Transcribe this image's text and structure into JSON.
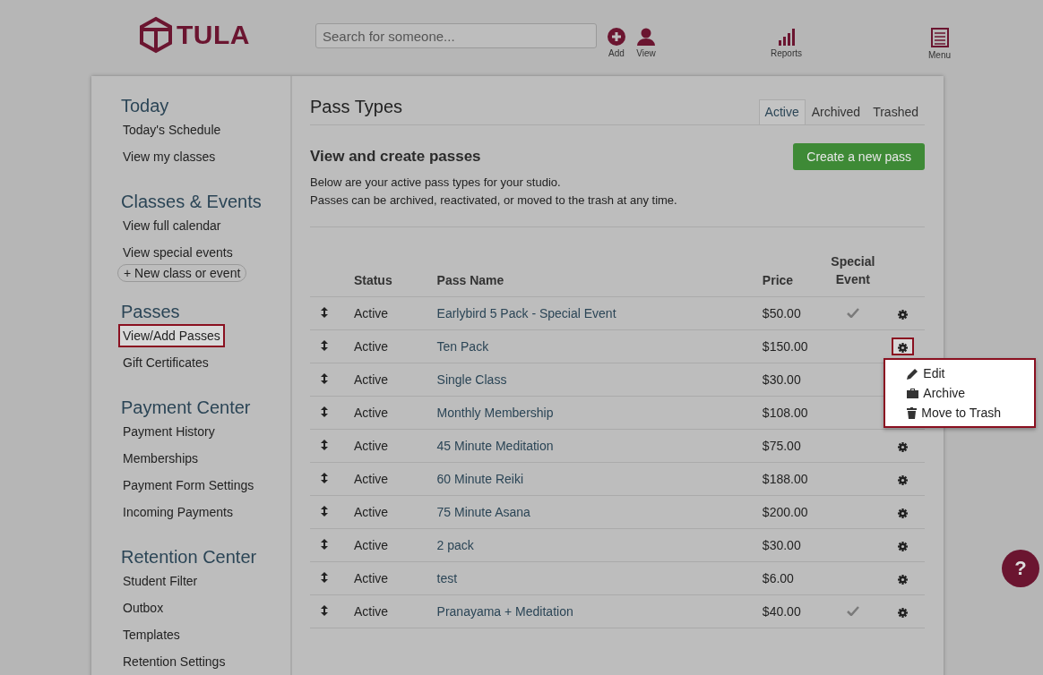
{
  "header": {
    "logo": "TULA",
    "search": {
      "placeholder": "Search for someone..."
    },
    "actions": [
      {
        "kind": "add",
        "label": "Add"
      },
      {
        "kind": "view",
        "label": "View"
      },
      {
        "kind": "reports",
        "label": "Reports"
      },
      {
        "kind": "menu",
        "label": "Menu"
      }
    ]
  },
  "sidebar": {
    "sections": [
      {
        "heading": "Today",
        "items": [
          {
            "kind": "link",
            "label": "Today's Schedule",
            "highlighted": false
          },
          {
            "kind": "link",
            "label": "View my classes",
            "highlighted": false
          }
        ]
      },
      {
        "heading": "Classes & Events",
        "items": [
          {
            "kind": "link",
            "label": "View full calendar",
            "highlighted": false
          },
          {
            "kind": "link",
            "label": "View special events",
            "highlighted": false
          },
          {
            "kind": "button",
            "label": "+ New class or event",
            "highlighted": false
          }
        ]
      },
      {
        "heading": "Passes",
        "items": [
          {
            "kind": "link",
            "label": "View/Add Passes",
            "highlighted": true
          },
          {
            "kind": "link",
            "label": "Gift Certificates",
            "highlighted": false
          }
        ]
      },
      {
        "heading": "Payment Center",
        "items": [
          {
            "kind": "link",
            "label": "Payment History",
            "highlighted": false
          },
          {
            "kind": "link",
            "label": "Memberships",
            "highlighted": false
          },
          {
            "kind": "link",
            "label": "Payment Form Settings",
            "highlighted": false
          },
          {
            "kind": "link",
            "label": "Incoming Payments",
            "highlighted": false
          }
        ]
      },
      {
        "heading": "Retention Center",
        "items": [
          {
            "kind": "link",
            "label": "Student Filter",
            "highlighted": false
          },
          {
            "kind": "link",
            "label": "Outbox",
            "highlighted": false
          },
          {
            "kind": "link",
            "label": "Templates",
            "highlighted": false
          },
          {
            "kind": "link",
            "label": "Retention Settings",
            "highlighted": false
          }
        ]
      }
    ]
  },
  "main": {
    "title": "Pass Types",
    "tabs": [
      {
        "label": "Active",
        "selected": true
      },
      {
        "label": "Archived",
        "selected": false
      },
      {
        "label": "Trashed",
        "selected": false
      }
    ],
    "subtitle": "View and create passes",
    "create_button": "Create a new pass",
    "description": [
      "Below are your active pass types for your studio.",
      "Passes can be archived, reactivated, or moved to the trash at any time."
    ],
    "table": {
      "columns": [
        "Status",
        "Pass Name",
        "Price",
        "Special Event"
      ],
      "rows": [
        {
          "status": "Active",
          "name": "Earlybird 5 Pack - Special Event",
          "price": "$50.00",
          "special_event": true,
          "menu_open": false
        },
        {
          "status": "Active",
          "name": "Ten Pack",
          "price": "$150.00",
          "special_event": false,
          "menu_open": true
        },
        {
          "status": "Active",
          "name": "Single Class",
          "price": "$30.00",
          "special_event": false,
          "menu_open": false
        },
        {
          "status": "Active",
          "name": "Monthly Membership",
          "price": "$108.00",
          "special_event": false,
          "menu_open": false
        },
        {
          "status": "Active",
          "name": "45 Minute Meditation",
          "price": "$75.00",
          "special_event": false,
          "menu_open": false
        },
        {
          "status": "Active",
          "name": "60 Minute Reiki",
          "price": "$188.00",
          "special_event": false,
          "menu_open": false
        },
        {
          "status": "Active",
          "name": "75 Minute Asana",
          "price": "$200.00",
          "special_event": false,
          "menu_open": false
        },
        {
          "status": "Active",
          "name": "2 pack",
          "price": "$30.00",
          "special_event": false,
          "menu_open": false
        },
        {
          "status": "Active",
          "name": "test",
          "price": "$6.00",
          "special_event": false,
          "menu_open": false
        },
        {
          "status": "Active",
          "name": "Pranayama + Meditation",
          "price": "$40.00",
          "special_event": true,
          "menu_open": false
        }
      ]
    },
    "row_menu": {
      "highlighted": true,
      "items": [
        {
          "kind": "edit",
          "label": "Edit"
        },
        {
          "kind": "archive",
          "label": "Archive"
        },
        {
          "kind": "trash",
          "label": "Move to Trash"
        }
      ]
    }
  },
  "help_button": "?"
}
